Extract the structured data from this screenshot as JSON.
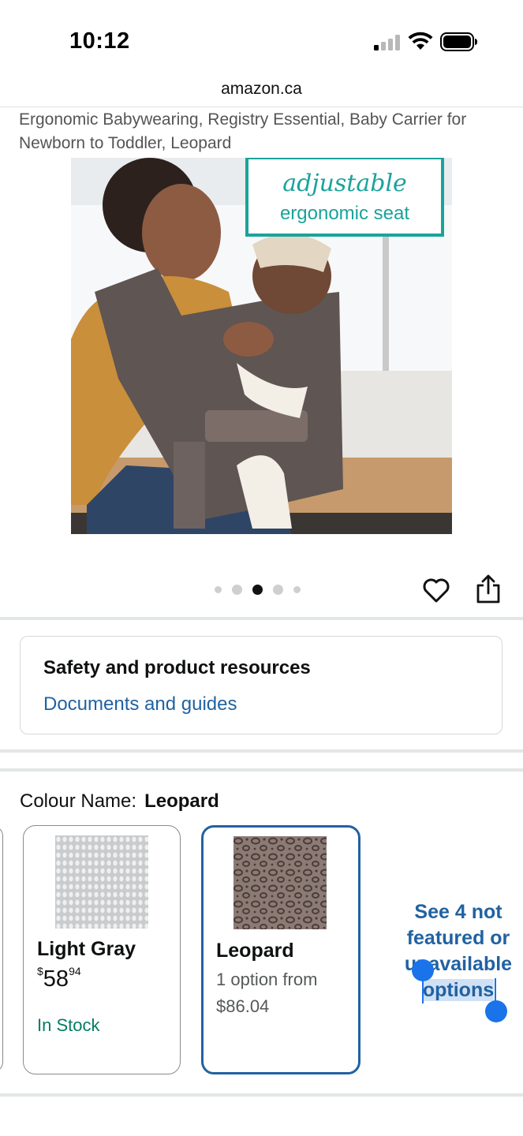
{
  "status_bar": {
    "time": "10:12"
  },
  "browser": {
    "url": "amazon.ca"
  },
  "product": {
    "title": "Ergonomic Babywearing, Registry Essential, Baby Carrier for Newborn to Toddler, Leopard",
    "image": {
      "banner_script": "adjustable",
      "banner_text": "ergonomic seat",
      "accent_color": "#1aa39b"
    },
    "carousel": {
      "dot_count": 5,
      "active_index": 2
    }
  },
  "resources": {
    "heading": "Safety and product resources",
    "link": "Documents and guides"
  },
  "colour": {
    "label": "Colour Name:",
    "selected": "Leopard",
    "options": [
      {
        "name": "Light Gray",
        "price_symbol": "$",
        "price_whole": "58",
        "price_fraction": "94",
        "stock": "In Stock"
      },
      {
        "name": "Leopard",
        "line1": "1 option from",
        "line2": "$86.04"
      }
    ],
    "see_more": {
      "line1": "See 4 not",
      "line2": "featured or",
      "line3": "unavailable",
      "line4": "options"
    }
  },
  "colors": {
    "link_blue": "#2162a1",
    "stock_green": "#067d62",
    "selection_blue": "#1a73e8"
  }
}
